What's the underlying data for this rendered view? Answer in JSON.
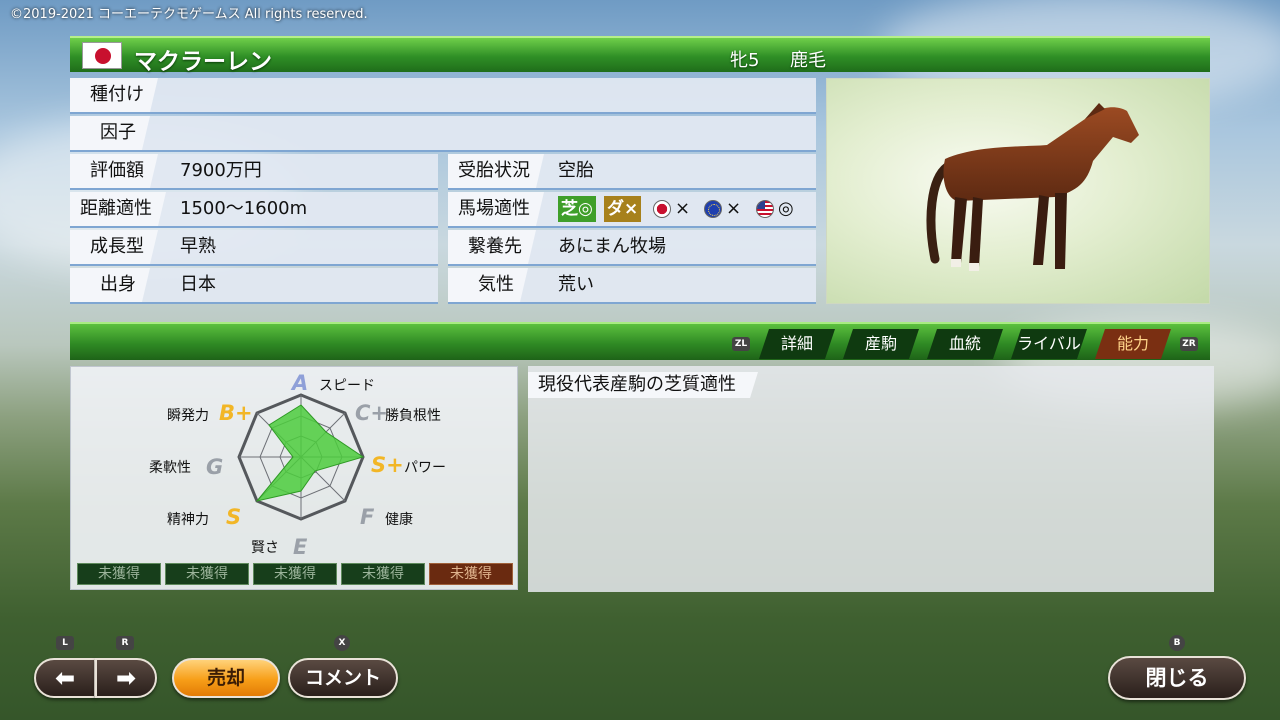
{
  "copyright": "©2019-2021 コーエーテクモゲームス All rights reserved.",
  "header": {
    "name": "マクラーレン",
    "sex_age": "牝5",
    "coat": "鹿毛"
  },
  "info": {
    "breeding_label": "種付け",
    "breeding_value": "",
    "factor_label": "因子",
    "factor_value": "",
    "price_label": "評価額",
    "price_value": "7900万円",
    "distance_label": "距離適性",
    "distance_value": "1500〜1600m",
    "growth_label": "成長型",
    "growth_value": "早熟",
    "origin_label": "出身",
    "origin_value": "日本",
    "pregnancy_label": "受胎状況",
    "pregnancy_value": "空胎",
    "surface_label": "馬場適性",
    "surface": {
      "turf": "芝◎",
      "dirt": "ダ×",
      "jp_mark": "×",
      "eu_mark": "×",
      "us_mark": "◎"
    },
    "farm_label": "繋養先",
    "farm_value": "あにまん牧場",
    "temper_label": "気性",
    "temper_value": "荒い"
  },
  "tabs": {
    "left_key": "ZL",
    "right_key": "ZR",
    "items": [
      "詳細",
      "産駒",
      "血統",
      "ライバル",
      "能力"
    ],
    "active": "能力"
  },
  "radar": {
    "labels": {
      "speed": "スピード",
      "guts": "勝負根性",
      "power": "パワー",
      "health": "健康",
      "wisdom": "賢さ",
      "spirit": "精神力",
      "flex": "柔軟性",
      "burst": "瞬発力"
    },
    "grades": {
      "speed": "A",
      "guts": "C+",
      "power": "S+",
      "health": "F",
      "wisdom": "E",
      "spirit": "S",
      "flex": "G",
      "burst": "B+"
    },
    "colors": {
      "A": "#8fa0d8",
      "C": "#9aa0a8",
      "S": "#f2b626",
      "F": "#9aa0a8",
      "E": "#9aa0a8",
      "G": "#9aa0a8",
      "B": "#f2b626"
    },
    "fill_color": "#4ccc3d"
  },
  "skills": [
    "未獲得",
    "未獲得",
    "未獲得",
    "未獲得",
    "未獲得"
  ],
  "info_title": "現役代表産駒の芝質適性",
  "buttons": {
    "prev_key": "L",
    "next_key": "R",
    "sell": "売却",
    "comment": "コメント",
    "comment_key": "X",
    "close": "閉じる",
    "close_key": "B"
  }
}
